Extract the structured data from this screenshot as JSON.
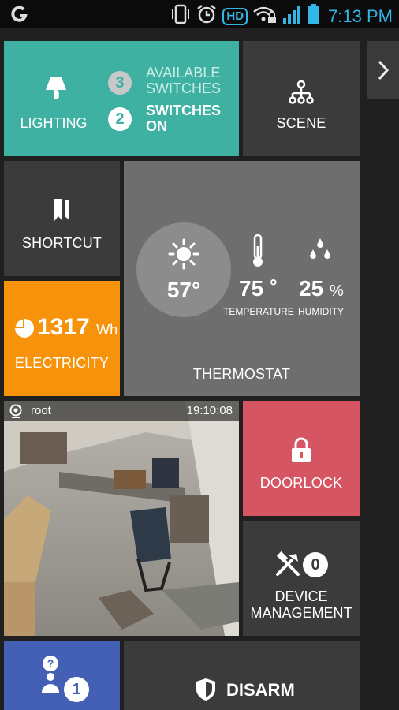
{
  "status_bar": {
    "time": "7:13 PM",
    "hd_label": "HD",
    "icons": [
      "app-logo-icon",
      "vibrate-icon",
      "alarm-icon",
      "hd-voice-icon",
      "wifi-lock-icon",
      "signal-icon",
      "battery-icon"
    ]
  },
  "colors": {
    "lighting": "#3fb1a3",
    "dark_tile": "#3b3b3b",
    "thermostat": "#6e6e6e",
    "electricity": "#f7930a",
    "doorlock": "#d55662",
    "blue_tile": "#4460b4",
    "status_time": "#33b5e5"
  },
  "lighting": {
    "label": "LIGHTING",
    "available_count": "3",
    "available_label_1": "AVAILABLE",
    "available_label_2": "SWITCHES",
    "on_count": "2",
    "on_label_1": "SWITCHES",
    "on_label_2": "ON"
  },
  "scene": {
    "label": "SCENE"
  },
  "shortcut": {
    "label": "SHORTCUT"
  },
  "thermostat": {
    "label": "THERMOSTAT",
    "outdoor_temp": "57°",
    "temperature_value": "75",
    "temperature_unit": "°",
    "temperature_label": "TEMPERATURE",
    "humidity_value": "25",
    "humidity_unit": "%",
    "humidity_label": "HUMIDITY"
  },
  "electricity": {
    "label": "ELECTRICITY",
    "value": "1317",
    "unit": "Wh"
  },
  "camera": {
    "user": "root",
    "timestamp": "19:10:08"
  },
  "doorlock": {
    "label": "DOORLOCK"
  },
  "device_management": {
    "label_1": "DEVICE",
    "label_2": "MANAGEMENT",
    "count": "0"
  },
  "help": {
    "count": "1"
  },
  "security": {
    "label": "DISARM"
  }
}
